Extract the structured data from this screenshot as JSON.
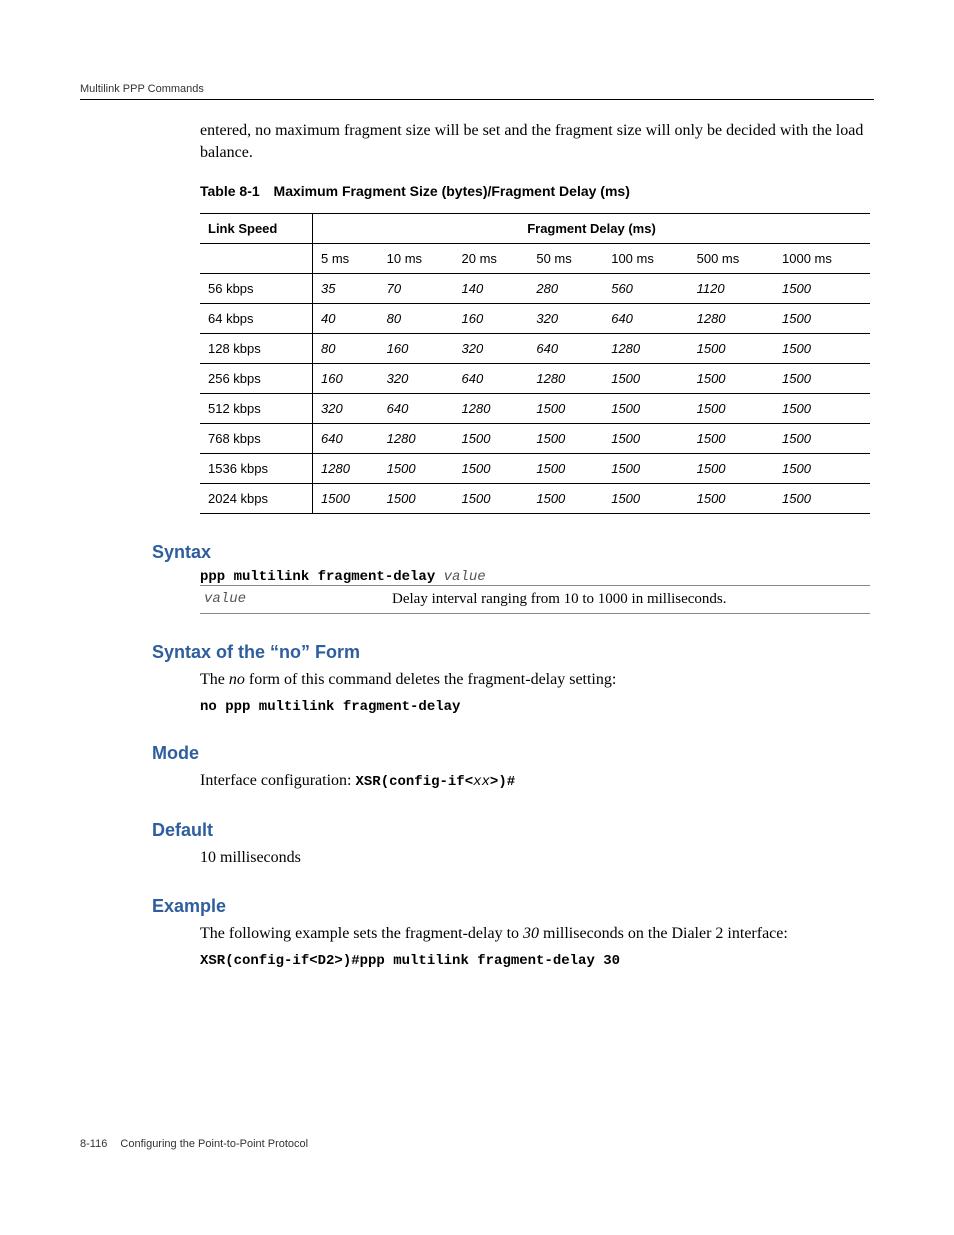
{
  "header": {
    "section": "Multilink PPP Commands"
  },
  "intro": "entered, no maximum fragment size will be set and the fragment size will only be decided with the load balance.",
  "table": {
    "caption_num": "Table 8-1",
    "caption_text": "Maximum Fragment Size (bytes)/Fragment Delay (ms)",
    "col1_header": "Link Speed",
    "span_header": "Fragment Delay (ms)",
    "sub_headers": [
      "5 ms",
      "10 ms",
      "20 ms",
      "50 ms",
      "100 ms",
      "500 ms",
      "1000 ms"
    ],
    "rows": [
      {
        "speed": "56 kbps",
        "vals": [
          "35",
          "70",
          "140",
          "280",
          "560",
          "1120",
          "1500"
        ]
      },
      {
        "speed": "64 kbps",
        "vals": [
          "40",
          "80",
          "160",
          "320",
          "640",
          "1280",
          "1500"
        ]
      },
      {
        "speed": "128 kbps",
        "vals": [
          "80",
          "160",
          "320",
          "640",
          "1280",
          "1500",
          "1500"
        ]
      },
      {
        "speed": "256 kbps",
        "vals": [
          "160",
          "320",
          "640",
          "1280",
          "1500",
          "1500",
          "1500"
        ]
      },
      {
        "speed": "512 kbps",
        "vals": [
          "320",
          "640",
          "1280",
          "1500",
          "1500",
          "1500",
          "1500"
        ]
      },
      {
        "speed": "768 kbps",
        "vals": [
          "640",
          "1280",
          "1500",
          "1500",
          "1500",
          "1500",
          "1500"
        ]
      },
      {
        "speed": "1536 kbps",
        "vals": [
          "1280",
          "1500",
          "1500",
          "1500",
          "1500",
          "1500",
          "1500"
        ]
      },
      {
        "speed": "2024 kbps",
        "vals": [
          "1500",
          "1500",
          "1500",
          "1500",
          "1500",
          "1500",
          "1500"
        ]
      }
    ]
  },
  "syntax": {
    "heading": "Syntax",
    "cmd": "ppp multilink fragment-delay ",
    "arg": "value",
    "param_name": "value",
    "param_desc": "Delay interval ranging from 10 to 1000 in milliseconds."
  },
  "noform": {
    "heading": "Syntax of the “no” Form",
    "text_pre": "The ",
    "text_ital": "no",
    "text_post": " form of this command deletes the fragment-delay setting:",
    "cmd": "no ppp multilink fragment-delay"
  },
  "mode": {
    "heading": "Mode",
    "text": "Interface configuration: ",
    "code_pre": "XSR(config-if<",
    "code_ital": "xx",
    "code_post": ">)#"
  },
  "default": {
    "heading": "Default",
    "text": "10 milliseconds"
  },
  "example": {
    "heading": "Example",
    "text_pre": "The following example sets the fragment-delay to ",
    "text_ital": "30",
    "text_post": " milliseconds on the Dialer 2 interface:",
    "cmd": "XSR(config-if<D2>)#ppp multilink fragment-delay 30"
  },
  "footer": {
    "page": "8-116",
    "chapter": "Configuring the Point-to-Point Protocol"
  }
}
